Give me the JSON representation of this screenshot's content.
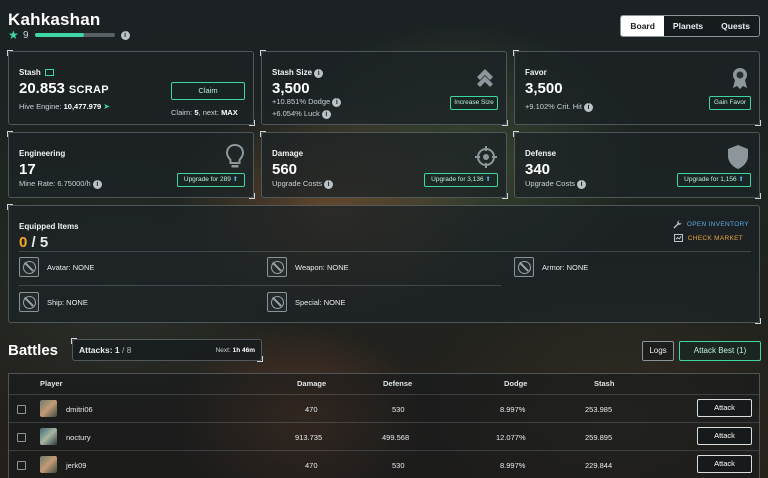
{
  "header": {
    "title": "Kahkashan",
    "level": "9",
    "xp_progress": 0.62,
    "tabs": [
      {
        "label": "Board",
        "active": true
      },
      {
        "label": "Planets",
        "active": false
      },
      {
        "label": "Quests",
        "active": false
      }
    ]
  },
  "stash": {
    "label": "Stash",
    "value": "20.853",
    "currency": "SCRAP",
    "hive_engine_label": "Hive Engine:",
    "hive_engine_value": "10,477.979",
    "claim_button": "Claim",
    "claim_label": "Claim:",
    "claim_value": "5",
    "next_label": ", next:",
    "next_value": "MAX"
  },
  "stash_size": {
    "label": "Stash Size",
    "value": "3,500",
    "dodge_value": "+10.851%",
    "dodge_label": "Dodge",
    "luck_value": "+6.054%",
    "luck_label": "Luck",
    "button": "Increase Size"
  },
  "favor": {
    "label": "Favor",
    "value": "3,500",
    "crit_value": "+9.102%",
    "crit_label": "Crit. Hit",
    "button": "Gain Favor"
  },
  "engineering": {
    "label": "Engineering",
    "value": "17",
    "mine_rate": "Mine Rate: 6.75000/h",
    "button": "Upgrade for 289"
  },
  "damage": {
    "label": "Damage",
    "value": "560",
    "sub": "Upgrade Costs",
    "button": "Upgrade for 3,136"
  },
  "defense": {
    "label": "Defense",
    "value": "340",
    "sub": "Upgrade Costs",
    "button": "Upgrade for 1,156"
  },
  "equipped": {
    "label": "Equipped Items",
    "count": "0",
    "total": "/ 5",
    "open_inventory": "OPEN INVENTORY",
    "check_market": "CHECK MARKET",
    "slots": [
      "Avatar: NONE",
      "Weapon: NONE",
      "Armor: NONE",
      "Ship: NONE",
      "Special: NONE"
    ]
  },
  "battles": {
    "title": "Battles",
    "attacks_label": "Attacks:",
    "attacks_used": "1",
    "attacks_total": "/ 8",
    "next_label": "Next:",
    "next_value": "1h 46m",
    "logs_button": "Logs",
    "attack_best_button": "Attack Best (1)",
    "columns": [
      "Player",
      "Damage",
      "Defense",
      "Dodge",
      "Stash"
    ],
    "rows": [
      {
        "player": "dmitri06",
        "damage": "470",
        "defense": "530",
        "dodge": "8.997%",
        "stash": "253.985",
        "action": "Attack"
      },
      {
        "player": "noctury",
        "damage": "913.735",
        "defense": "499.568",
        "dodge": "12.077%",
        "stash": "259.895",
        "action": "Attack"
      },
      {
        "player": "jerk09",
        "damage": "470",
        "defense": "530",
        "dodge": "8.997%",
        "stash": "229.844",
        "action": "Attack"
      }
    ]
  },
  "colors": {
    "accent": "#3ed6a2",
    "equipped_count": "#f4a81d",
    "link_blue": "#5aa9e6",
    "link_orange": "#e6a443"
  },
  "icons": [
    "star-icon",
    "info-icon",
    "chevrons-up-icon",
    "medal-icon",
    "lightbulb-icon",
    "crosshair-icon",
    "shield-icon",
    "wrench-icon",
    "market-icon",
    "ban-icon",
    "send-icon"
  ]
}
